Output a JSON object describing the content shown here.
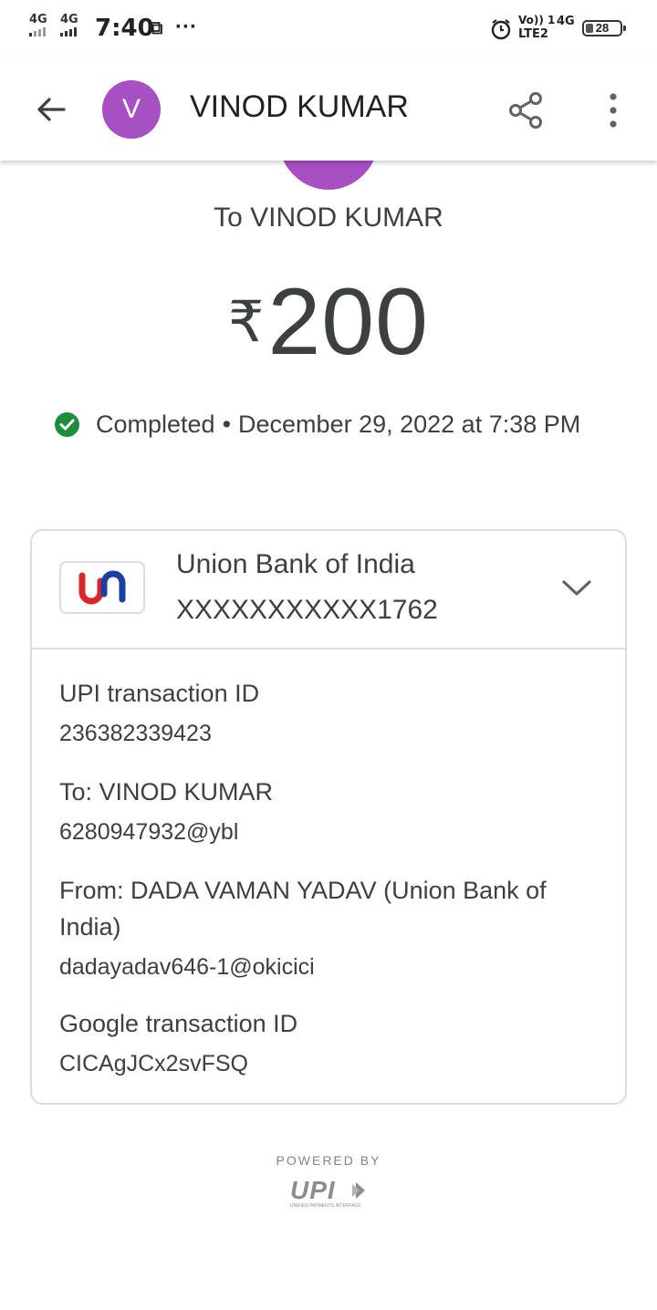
{
  "status_bar": {
    "sim1": "4G",
    "sim2": "4G",
    "time": "7:40",
    "more": "···",
    "volte": "Vo)) 1",
    "lte": "LTE2",
    "net": "4G",
    "battery": "28"
  },
  "header": {
    "avatar_letter": "V",
    "contact_name": "VINOD KUMAR"
  },
  "summary": {
    "to_line": "To VINOD KUMAR",
    "currency": "₹",
    "amount": "200",
    "status": "Completed",
    "separator": "•",
    "datetime": "December 29, 2022 at 7:38 PM"
  },
  "bank": {
    "name": "Union Bank of India",
    "account": "XXXXXXXXXXX1762"
  },
  "details": {
    "upi_label": "UPI transaction ID",
    "upi_value": "236382339423",
    "to_label": "To: VINOD KUMAR",
    "to_value": "6280947932@ybl",
    "from_label": "From: DADA VAMAN YADAV (Union Bank of India)",
    "from_value": "dadayadav646-1@okicici",
    "google_label": "Google transaction ID",
    "google_value": "CICAgJCx2svFSQ"
  },
  "footer": {
    "powered_by": "POWERED BY",
    "upi_text": "UPI",
    "upi_tagline": "UNIFIED PAYMENTS INTERFACE"
  },
  "colors": {
    "avatar": "#a84fc4",
    "success": "#1e8e3e",
    "text": "#3c4043",
    "border": "#dadce0",
    "union_red": "#d7262b",
    "union_blue": "#1b3f9c"
  }
}
